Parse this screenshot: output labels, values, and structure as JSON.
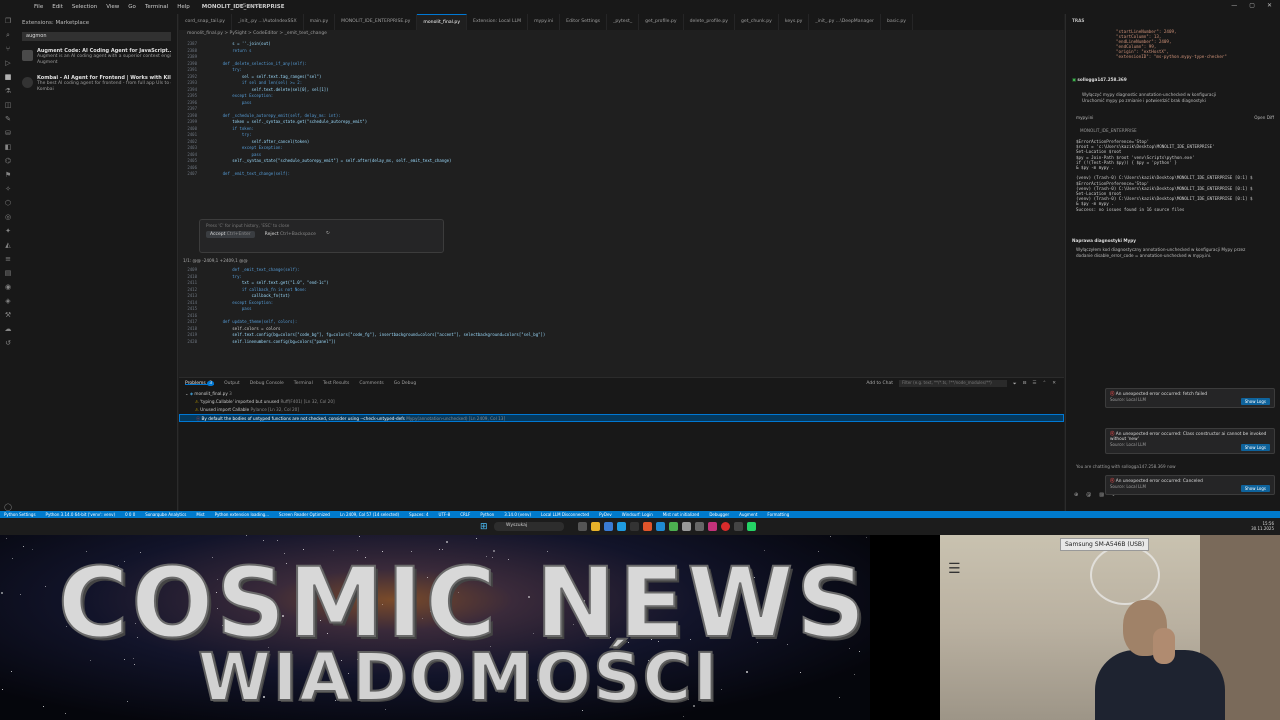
{
  "titlebar": {
    "menus": [
      "File",
      "Edit",
      "Selection",
      "View",
      "Go",
      "Terminal",
      "Help"
    ],
    "project": "MONOLIT_IDE_ENTERPRISE",
    "search": "Search"
  },
  "sidebar": {
    "header": "Extensions: Marketplace",
    "search_value": "augmon",
    "extensions": [
      {
        "name": "Augment Code: AI Coding Agent for JavaScript...",
        "desc": "Augment is an AI coding agent with a superior context engine and age...",
        "publisher": "Augment"
      },
      {
        "name": "Kombai - AI Agent for Frontend | Works with KiloCode...",
        "desc": "The best AI coding agent for frontend - from full app UIs to com...",
        "publisher": "Kombai"
      }
    ]
  },
  "editor": {
    "tabs": [
      "cord_snap_tail.py",
      "_init_.py ...\\AutoIndexSSX",
      "main.py",
      "MONOLIT_IDE_ENTERPRISE.py",
      "monolit_final.py",
      "Extension: Local LLM",
      "mypy.ini",
      "Editor Settings",
      "_pytest_",
      "get_profile.py",
      "delete_profile.py",
      "get_chunk.py",
      "keys.py",
      "_init_.py ...\\DeepManager",
      "basic.py"
    ],
    "active_tab": "monolit_final.py",
    "breadcrumb": "monolit_final.py  >  PySight  >  CodeEditor  >  _emit_text_change",
    "code_top": [
      {
        "n": "2387",
        "t": "        s = ''.join(out)"
      },
      {
        "n": "2388",
        "t": "        return s"
      },
      {
        "n": "2389",
        "t": ""
      },
      {
        "n": "2390",
        "t": "    def _delete_selection_if_any(self):"
      },
      {
        "n": "2391",
        "t": "        try:"
      },
      {
        "n": "2392",
        "t": "            sel = self.text.tag_ranges(\"sel\")"
      },
      {
        "n": "2393",
        "t": "            if sel and len(sel) >= 2:"
      },
      {
        "n": "2394",
        "t": "                self.text.delete(sel[0], sel[1])"
      },
      {
        "n": "2395",
        "t": "        except Exception:"
      },
      {
        "n": "2396",
        "t": "            pass"
      },
      {
        "n": "2397",
        "t": ""
      },
      {
        "n": "2398",
        "t": "    def _schedule_autorepy_emit(self, delay_ms: int):"
      },
      {
        "n": "2399",
        "t": "        token = self._syntax_state.get(\"schedule_autorepy_emit\")"
      },
      {
        "n": "2400",
        "t": "        if token:"
      },
      {
        "n": "2401",
        "t": "            try:"
      },
      {
        "n": "2402",
        "t": "                self.after_cancel(token)"
      },
      {
        "n": "2403",
        "t": "            except Exception:"
      },
      {
        "n": "2404",
        "t": "                pass"
      },
      {
        "n": "2405",
        "t": "        self._syntax_state[\"schedule_autorepy_emit\"] = self.after(delay_ms, self._emit_text_change)"
      },
      {
        "n": "2406",
        "t": ""
      },
      {
        "n": "2407",
        "t": "    def _emit_text_change(self):"
      }
    ],
    "inline_chat_placeholder": "Press 'C' for input history, 'ESC' to close",
    "accept_label": "Accept",
    "accept_hint": "Ctrl+Enter",
    "reject_label": "Reject",
    "reject_hint": "Ctrl+Backspace",
    "diff_header": "1/1: @@ -2409,1 +2409,1 @@",
    "code_bottom": [
      {
        "n": "2409",
        "t": "        def _emit_text_change(self):"
      },
      {
        "n": "2410",
        "t": "        try:"
      },
      {
        "n": "2411",
        "t": "            txt = self.text.get(\"1.0\", \"end-1c\")"
      },
      {
        "n": "2412",
        "t": "            if callback_fn is not None:"
      },
      {
        "n": "2413",
        "t": "                callback_fn(txt)"
      },
      {
        "n": "2414",
        "t": "        except Exception:"
      },
      {
        "n": "2415",
        "t": "            pass"
      },
      {
        "n": "2416",
        "t": ""
      },
      {
        "n": "2417",
        "t": "    def update_theme(self, colors):"
      },
      {
        "n": "2418",
        "t": "        self.colors = colors"
      },
      {
        "n": "2419",
        "t": "        self.text.config(bg=colors[\"code_bg\"], fg=colors[\"code_fg\"], insertbackground=colors[\"accent\"], selectbackground=colors[\"sel_bg\"])"
      },
      {
        "n": "2420",
        "t": "        self.linenumbers.config(bg=colors[\"panel\"])"
      }
    ]
  },
  "panel": {
    "tabs": [
      "Problems",
      "Output",
      "Debug Console",
      "Terminal",
      "Test Results",
      "Comments",
      "Go Debug"
    ],
    "problems_count": "3",
    "add_to_chat": "Add to Chat",
    "filter_placeholder": "Filter (e.g. text, **/*.ts, !**/node_modules/**)",
    "file": "monolit_final.py",
    "file_count": "3",
    "problems": [
      {
        "kind": "warn",
        "text": "'typing.Callable' imported but unused",
        "src": "Ruff(F401) [Ln 32, Col 20]"
      },
      {
        "kind": "warn",
        "text": "Unused import Callable",
        "src": "Pylance [Ln 32, Col 20]"
      },
      {
        "kind": "err",
        "text": "By default the bodies of untyped functions are not checked, consider using --check-untyped-defs",
        "src": "Mypy(annotation-unchecked) [Ln 2409, Col 13]"
      }
    ]
  },
  "right": {
    "header": "TRAS",
    "json_lines": [
      "\"startLineNumber\": 2409,",
      "\"startColumn\": 13,",
      "\"endLineNumber\": 2409,",
      "\"endColumn\": 99,",
      "\"origin\": \"extHostX\",",
      "\"extensionID\": \"ms-python.mypy-type-checker\""
    ],
    "user": "sollogga147.258.369",
    "task_lines": [
      "Wyłączyć mypy diagnostic annotation-unchecked w konfiguracji",
      "Uruchomić mypy po zmianie i potwierdzić brak diagnostyki"
    ],
    "mypy_label": "mypy.ini",
    "open_diff": "Open Diff",
    "terminal_title": "MONOLIT_IDE_ENTERPRISE",
    "terminal_lines": [
      "$ErrorActionPreference='Stop'",
      "$root = 'c:\\Users\\kazik\\Desktop\\MONOLIT_IDE_ENTERPRISE'",
      "Set-Location $root",
      "$py = Join-Path $root 'venv\\Scripts\\python.exe'",
      "if (!(Test-Path $py)) { $py = 'python' }",
      "& $py -m mypy .",
      "",
      "(venv) (Trash-0) C:\\Users\\kazik\\Desktop\\MONOLIT_IDE_ENTERPRISE [0:1] $",
      "$ErrorActionPreference='Stop'",
      "(venv) (Trash-0) C:\\Users\\kazik\\Desktop\\MONOLIT_IDE_ENTERPRISE [0:1] $",
      "Set-Location $root",
      "(venv) (Trash-0) C:\\Users\\kazik\\Desktop\\MONOLIT_IDE_ENTERPRISE [0:1] $",
      "& $py -m mypy .",
      "Success: no issues found in 16 source files"
    ],
    "summary_title": "Naprawa diagnostyki Mypy",
    "summary_lines": [
      "Wyłączyłem kod diagnostyczny annotation-unchecked w konfiguracji Mypy przez",
      "dodanie disable_error_code = annotation-unchecked w mypy.ini."
    ],
    "chat_note": "You are chatting with sollogga147.258.369 now"
  },
  "toasts": [
    {
      "title": "An unexpected error occurred: fetch failed",
      "source": "Source: Local LLM",
      "action": "Show Logs"
    },
    {
      "title": "An unexpected error occurred: Class constructor ai cannot be invoked without 'new'",
      "source": "Source: Local LLM",
      "action": "Show Logs"
    },
    {
      "title": "An unexpected error occurred: Canceled",
      "source": "Source: Local LLM",
      "action": "Show Logs"
    }
  ],
  "statusbar": {
    "items": [
      "Python Settings",
      "Python 3.14.0 64-bit ('venv': venv)",
      "0  0  0",
      "Sonarqube Analytics",
      "Mist",
      "Python extension loading...",
      "Screen Reader Optimized",
      "Ln 2409, Col 57 (14 selected)",
      "Spaces: 4",
      "UTF-8",
      "CRLF",
      "Python",
      "3.14.0 (venv)",
      "Local LLM Disconnected",
      "PyDev",
      "Windsurf: Login",
      "Mist not initialized",
      "Debugger",
      "Augment",
      "Formatting"
    ]
  },
  "taskbar": {
    "search_label": "Wyszukaj",
    "clock_time": "15:56",
    "clock_date": "30.11.2025"
  },
  "banner": {
    "line1": "COSMIC NEWS",
    "line2": "WIADOMOŚCI"
  },
  "webcam": {
    "device_label": "Samsung SM-A546B (USB)"
  }
}
